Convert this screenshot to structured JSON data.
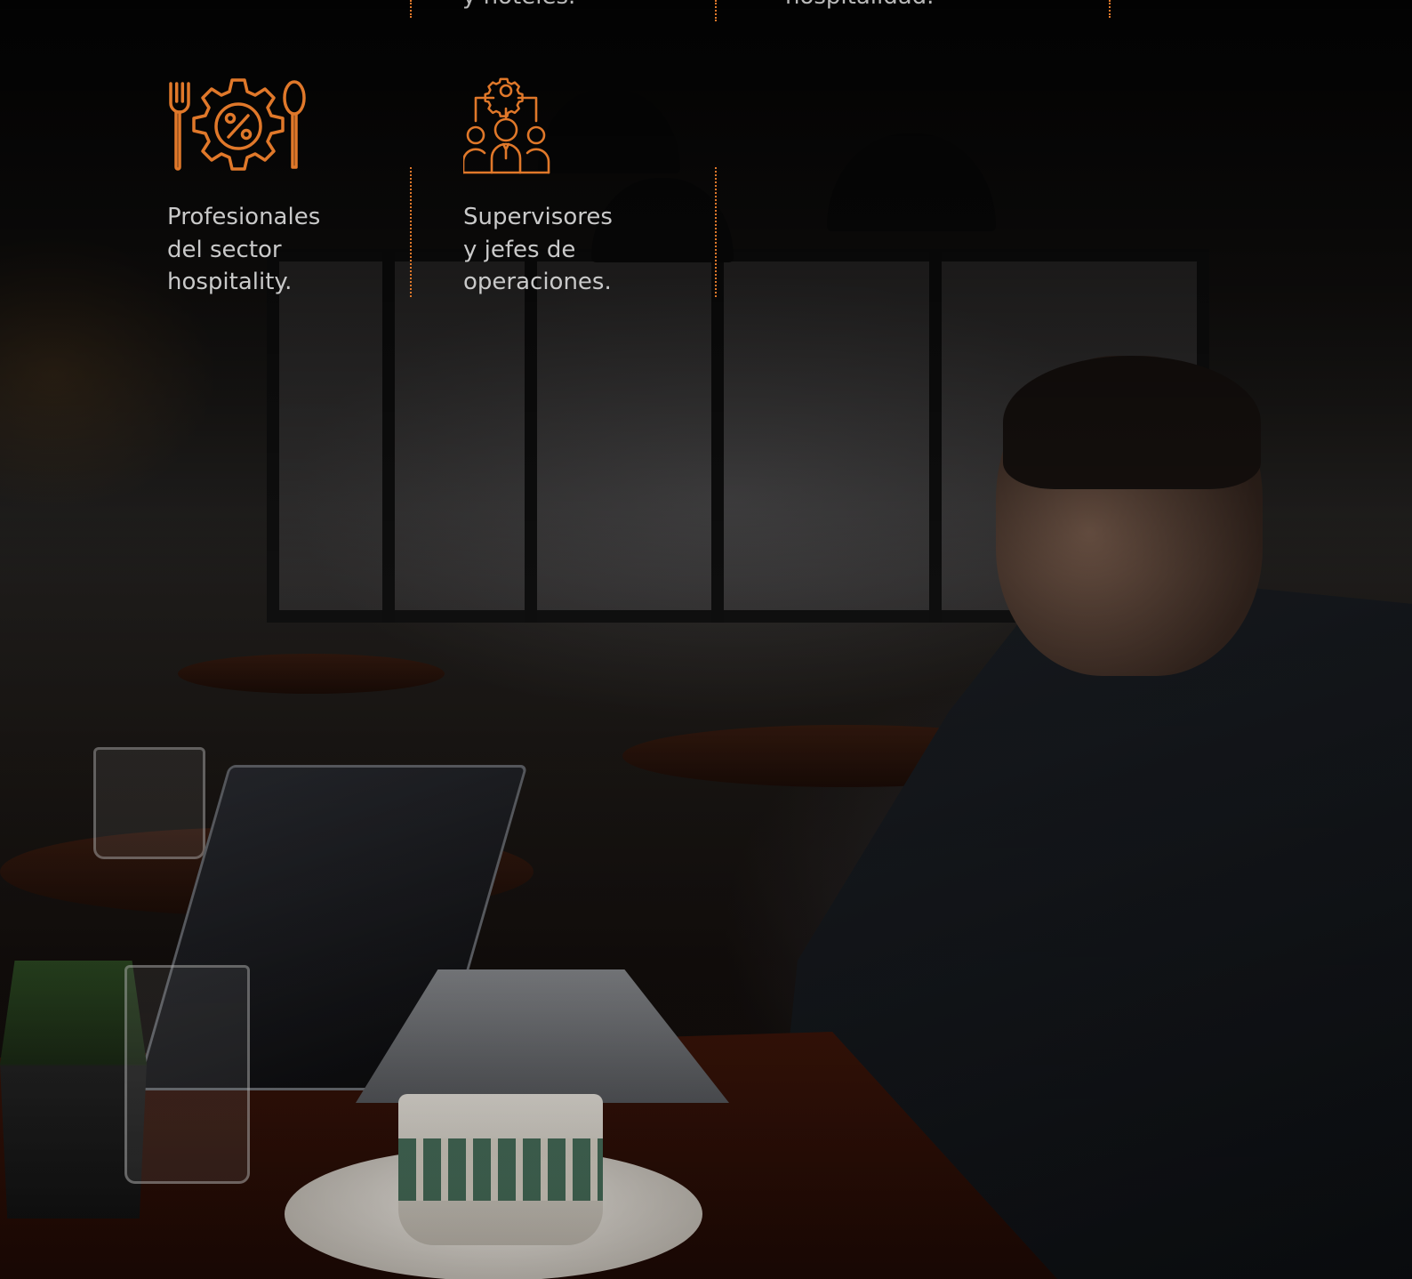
{
  "section": {
    "previous_row": [
      {
        "text": "y hoteles."
      },
      {
        "text": "hospitalidad."
      }
    ],
    "cards": [
      {
        "icon": "restaurant-cost-gear-icon",
        "label": "Profesionales\ndel sector\nhospitality."
      },
      {
        "icon": "team-management-icon",
        "label": "Supervisores\ny jefes de\noperaciones."
      }
    ]
  },
  "colors": {
    "accent": "#e0782a",
    "text": "#c9c9c9",
    "background": "#0b0b0b"
  }
}
